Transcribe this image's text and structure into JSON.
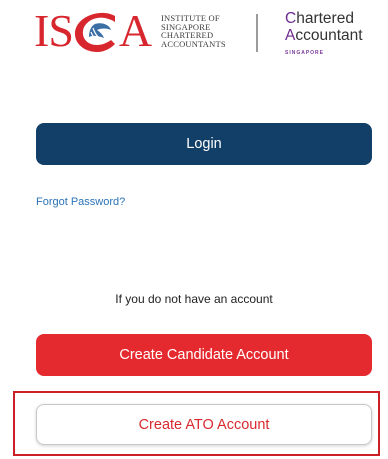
{
  "logo": {
    "isca_wordmark": "ISCA",
    "institute_lines": [
      "INSTITUTE OF",
      "SINGAPORE",
      "CHARTERED",
      "ACCOUNTANTS"
    ],
    "ca_line1": "Chartered",
    "ca_line2": "Accountant",
    "ca_sub": "SINGAPORE"
  },
  "login": {
    "label": "Login"
  },
  "forgot_password": "Forgot Password?",
  "no_account_text": "If you do not have an account",
  "create_candidate": "Create Candidate Account",
  "create_ato": "Create ATO Account",
  "colors": {
    "primary_navy": "#123f68",
    "accent_red": "#e52a2f",
    "link_blue": "#2a73b8",
    "brand_purple": "#6c2a8c"
  }
}
